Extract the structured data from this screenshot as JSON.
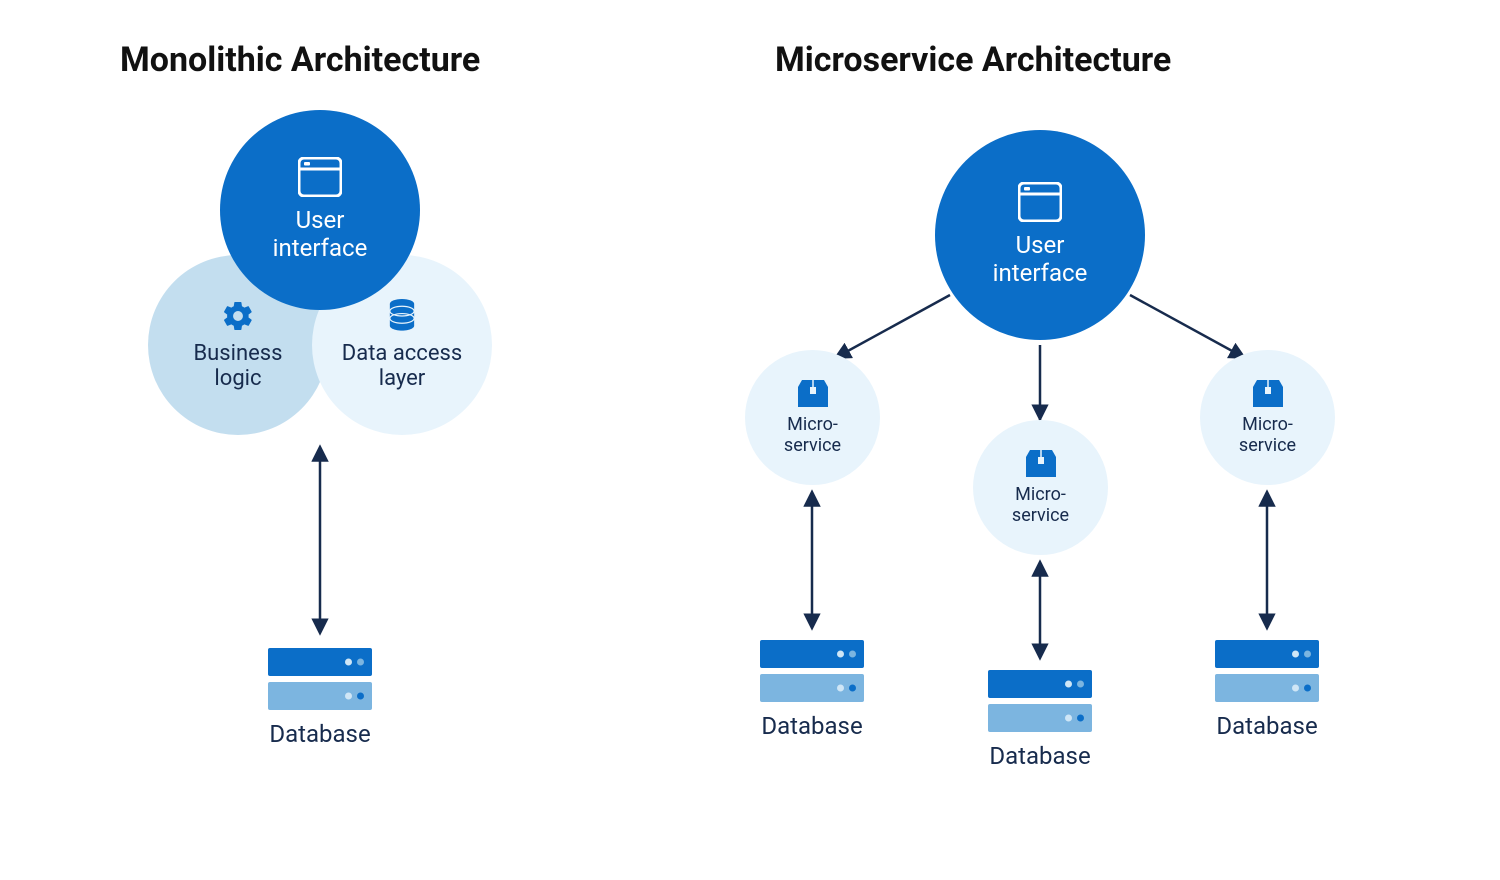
{
  "colors": {
    "primary": "#0b6ec8",
    "light": "#c3deef",
    "xlight": "#e8f4fc",
    "text": "#172b4d",
    "arrow": "#172b4d"
  },
  "left": {
    "title": "Monolithic Architecture",
    "ui": "User\ninterface",
    "business": "Business\nlogic",
    "data_access": "Data access\nlayer",
    "database": "Database"
  },
  "right": {
    "title": "Microservice Architecture",
    "ui": "User\ninterface",
    "micro": "Micro-\nservice",
    "database": "Database"
  }
}
